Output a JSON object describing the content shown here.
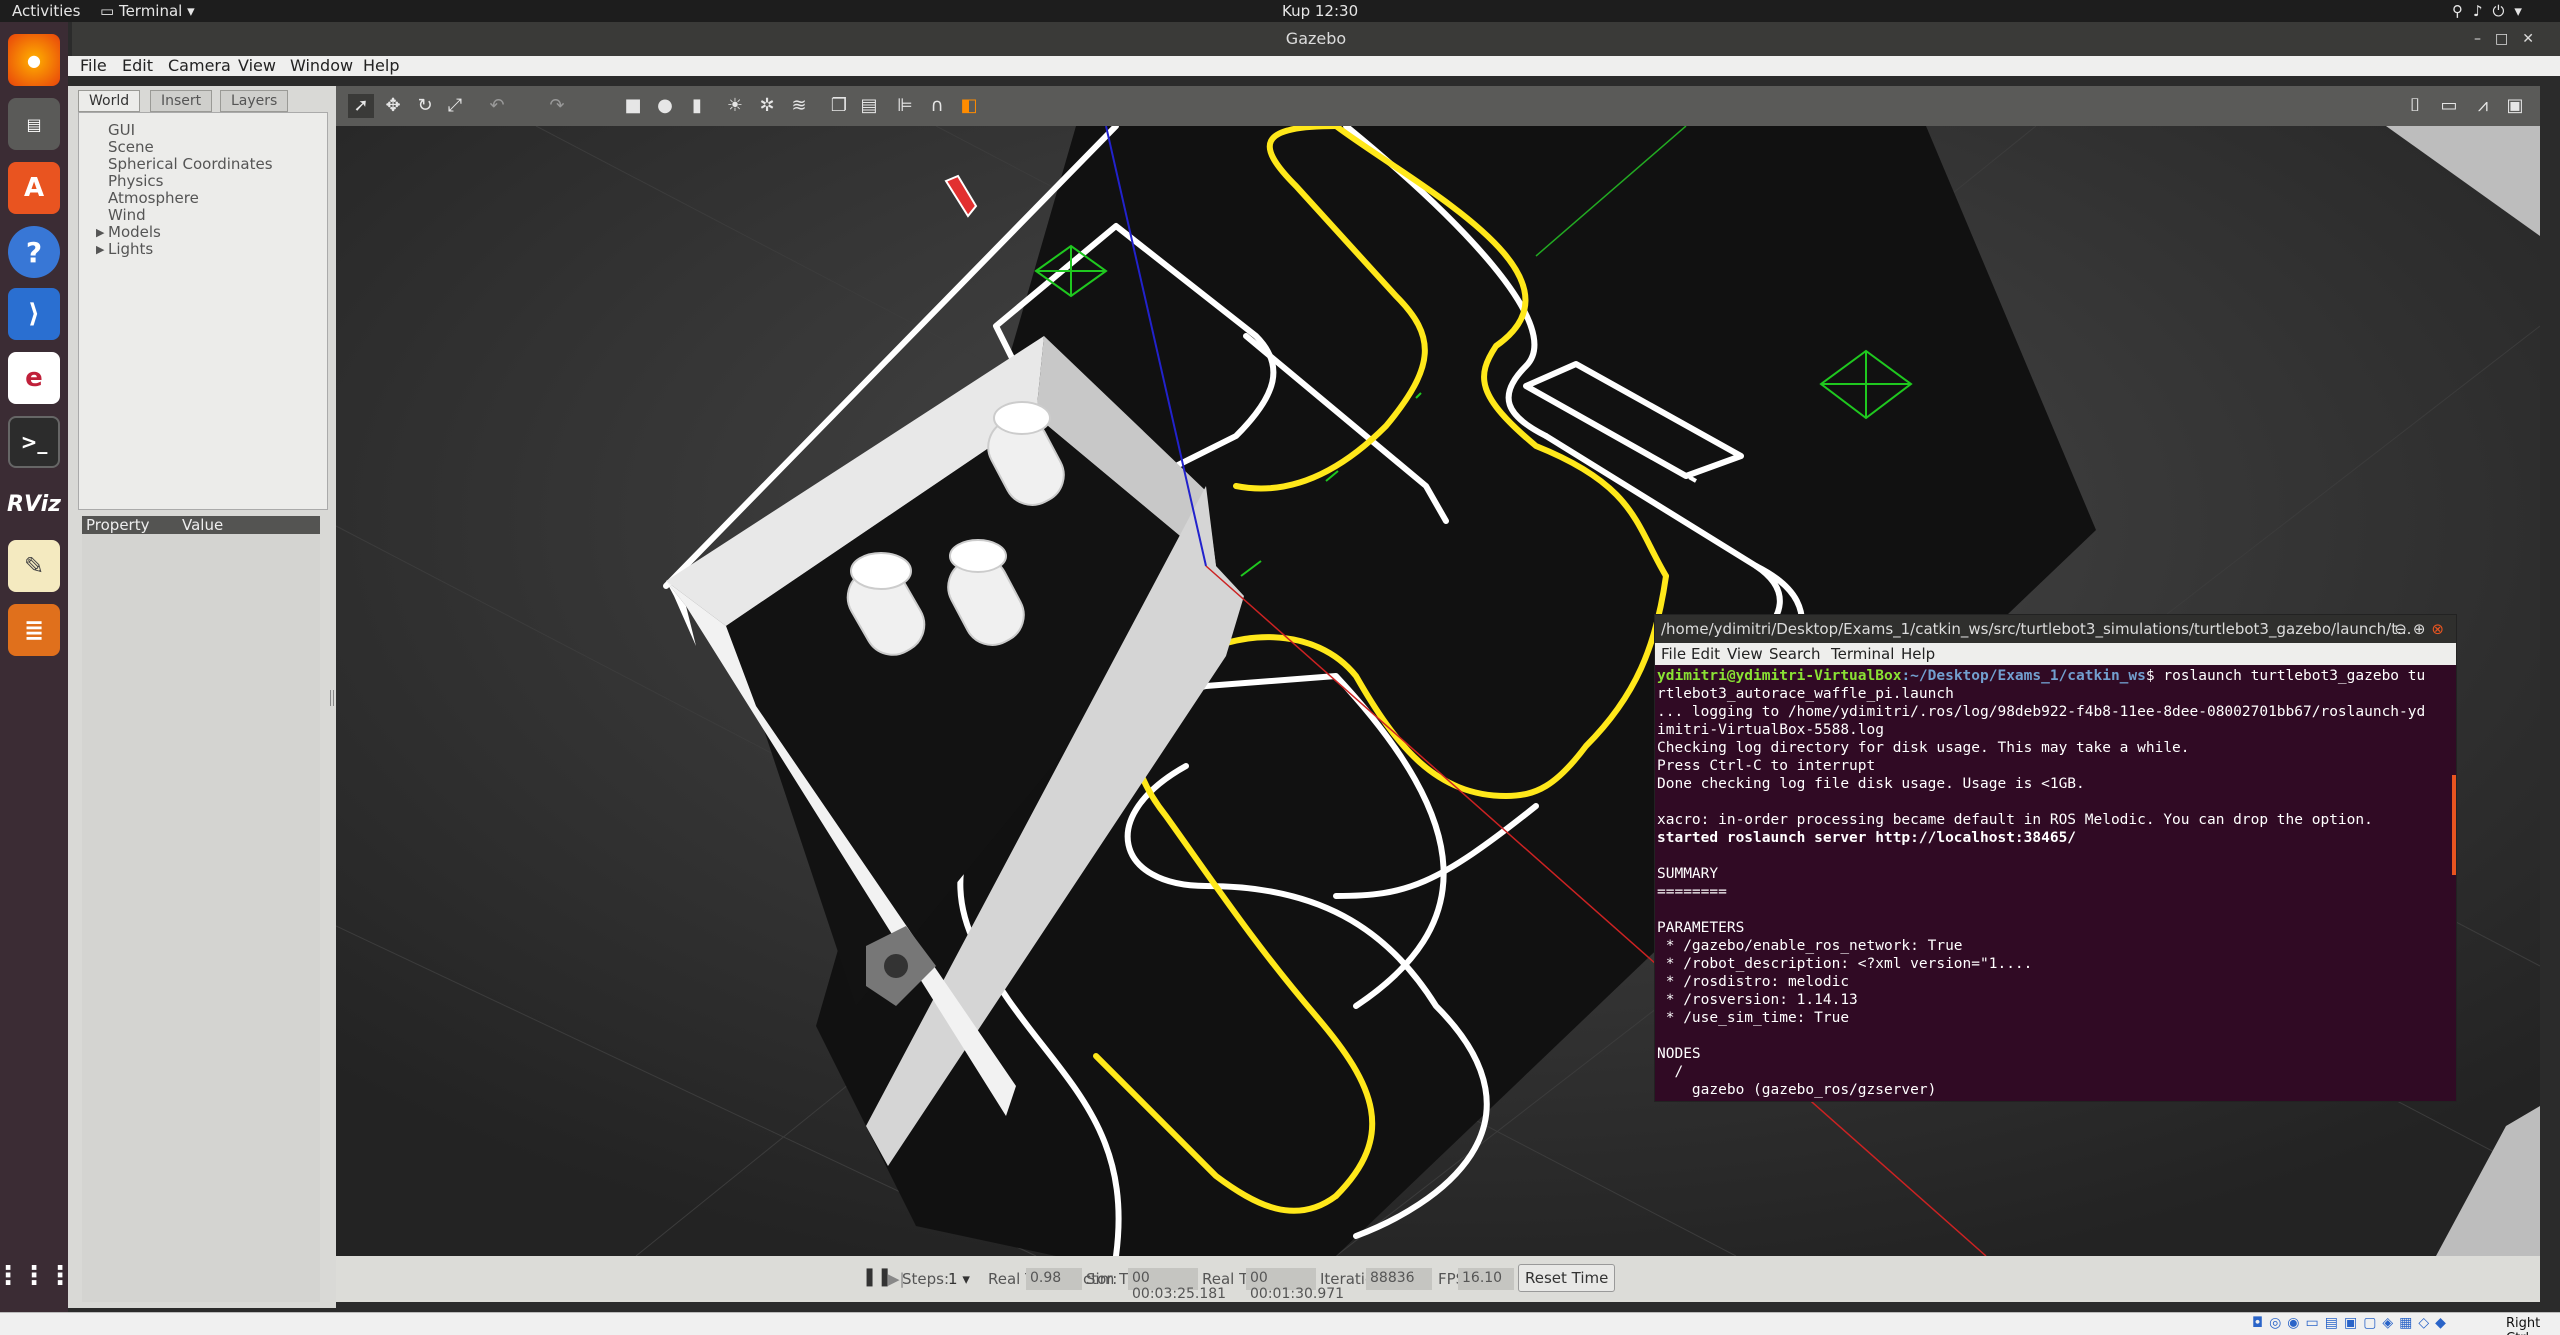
{
  "topbar": {
    "activities": "Activities",
    "app_menu": "Terminal",
    "clock": "Kup 12:30"
  },
  "window": {
    "title": "Gazebo"
  },
  "menubar": {
    "items": [
      "File",
      "Edit",
      "Camera",
      "View",
      "Window",
      "Help"
    ]
  },
  "left_panel": {
    "tabs": [
      "World",
      "Insert",
      "Layers"
    ],
    "tree": [
      "GUI",
      "Scene",
      "Spherical Coordinates",
      "Physics",
      "Atmosphere",
      "Wind",
      "Models",
      "Lights"
    ],
    "property_header": {
      "property": "Property",
      "value": "Value"
    }
  },
  "dock": {
    "items": [
      "firefox-icon",
      "files-icon",
      "software-icon",
      "help-icon",
      "vscode-icon",
      "editor-icon",
      "terminal-icon",
      "rviz-icon",
      "notes-icon",
      "stack-icon",
      "apps-grid-icon"
    ],
    "rviz_label": "RViz"
  },
  "bottom_bar": {
    "steps_label": "Steps:",
    "steps_value": "1",
    "rtf_label": "Real Time Factor:",
    "rtf_value": "0.98",
    "sim_time_label": "Sim Time:",
    "sim_time_value": "00 00:03:25.181",
    "real_time_label": "Real Time:",
    "real_time_value": "00 00:01:30.971",
    "iterations_label": "Iterations:",
    "iterations_value": "88836",
    "fps_label": "FPS:",
    "fps_value": "16.10",
    "reset_label": "Reset Time"
  },
  "terminal": {
    "title": "/home/ydimitri/Desktop/Exams_1/catkin_ws/src/turtlebot3_simulations/turtlebot3_gazebo/launch/t...",
    "menu": [
      "File",
      "Edit",
      "View",
      "Search",
      "Terminal",
      "Help"
    ],
    "prompt_user": "ydimitri@ydimitri-VirtualBox",
    "prompt_path": ":~/Desktop/Exams_1/catkin_ws",
    "command": "$ roslaunch turtlebot3_gazebo tu",
    "lines": [
      "rtlebot3_autorace_waffle_pi.launch",
      "... logging to /home/ydimitri/.ros/log/98deb922-f4b8-11ee-8dee-08002701bb67/roslaunch-yd",
      "imitri-VirtualBox-5588.log",
      "Checking log directory for disk usage. This may take a while.",
      "Press Ctrl-C to interrupt",
      "Done checking log file disk usage. Usage is <1GB.",
      "",
      "xacro: in-order processing became default in ROS Melodic. You can drop the option."
    ],
    "bold_line": "started roslaunch server http://localhost:38465/",
    "lines2": [
      "",
      "SUMMARY",
      "========",
      "",
      "PARAMETERS",
      " * /gazebo/enable_ros_network: True",
      " * /robot_description: <?xml version=\"1....",
      " * /rosdistro: melodic",
      " * /rosversion: 1.14.13",
      " * /use_sim_time: True",
      "",
      "NODES",
      "  /",
      "    gazebo (gazebo_ros/gzserver)"
    ]
  },
  "statusbar": {
    "right_ctrl": "Right Ctrl"
  },
  "colors": {
    "track_yellow": "#ffe81a",
    "track_white": "#ffffff",
    "terminal_bg": "#300a24"
  }
}
